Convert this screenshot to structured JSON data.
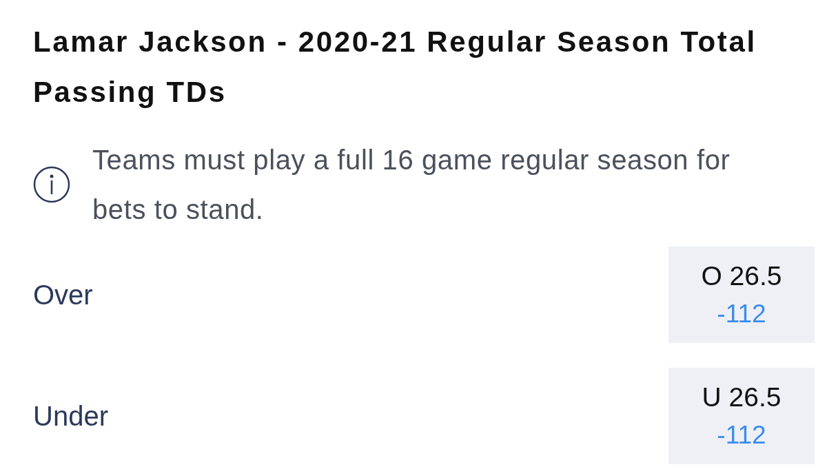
{
  "market": {
    "title_lines": [
      "Lamar Jackson - 2020-21 Regular Season Total",
      "Passing TDs"
    ],
    "note": "Teams must play a full 16 game regular season for bets to stand.",
    "outcomes": [
      {
        "label": "Over",
        "line": "O 26.5",
        "odds": "-112"
      },
      {
        "label": "Under",
        "line": "U 26.5",
        "odds": "-112"
      }
    ]
  }
}
